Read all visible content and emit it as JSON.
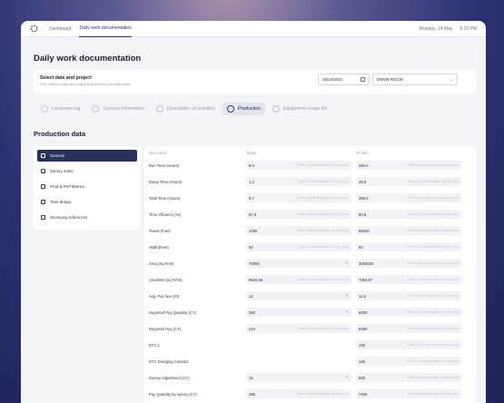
{
  "topbar": {
    "links": [
      "Dashboard",
      "Daily work documentation"
    ],
    "date": "Monday, 14 May",
    "time": "5:10 PM"
  },
  "page_title": "Daily work documentation",
  "date_card": {
    "title": "Select date and project",
    "subtitle": "First, select a date and project to document your daily work.",
    "date": "05/14/2024",
    "project": "DNNW ROCW"
  },
  "tabs": [
    "Leverman log",
    "General information",
    "Description of activities",
    "Production",
    "Equipment usage list"
  ],
  "section_title": "Production data",
  "sidebar": [
    "General",
    "Survey notes",
    "Prod & Perf Metrics",
    "Time delays",
    "Surveying references"
  ],
  "grid": {
    "headers": [
      "Item name",
      "Today",
      "To date"
    ],
    "comment_placeholder": "Enter a short description of your entry",
    "rows": [
      {
        "name": "Run Time (Hours)",
        "today": "8.0",
        "todate": "350.0"
      },
      {
        "name": "Delay Time (Hours)",
        "today": "1.2",
        "todate": "49.8"
      },
      {
        "name": "Total Time (Hours)",
        "today": "9.7",
        "todate": "395.0"
      },
      {
        "name": "Time efficiency (%)",
        "today": "87.6",
        "todate": "80.5"
      },
      {
        "name": "Travel (Feet)",
        "today": "1000",
        "todate": "60000"
      },
      {
        "name": "Width(Feet)",
        "today": "50",
        "todate": "50"
      },
      {
        "name": "Area (Sq Feet)",
        "today": "70000",
        "todate": "3000000"
      },
      {
        "name": "Area/WH (Sq Ft/Hr)",
        "today": "9820.55",
        "todate": "7093.67"
      },
      {
        "name": "Avg. Pay face (Ft)",
        "today": "12",
        "todate": "11.5"
      },
      {
        "name": "Reported Pay Quantity (CY)",
        "today": "280",
        "todate": "8000"
      },
      {
        "name": "Reported Pay (CY)",
        "today": "210",
        "todate": "8400"
      },
      {
        "name": "ETC 1",
        "today": "",
        "todate": "190"
      },
      {
        "name": "ETC Dredging Contract",
        "today": "",
        "todate": "120"
      },
      {
        "name": "Survey Adjustment (CY)",
        "today": "15",
        "todate": "600"
      },
      {
        "name": "Pay Quantity by survey (CY)",
        "today": "185",
        "todate": "7400"
      }
    ]
  }
}
